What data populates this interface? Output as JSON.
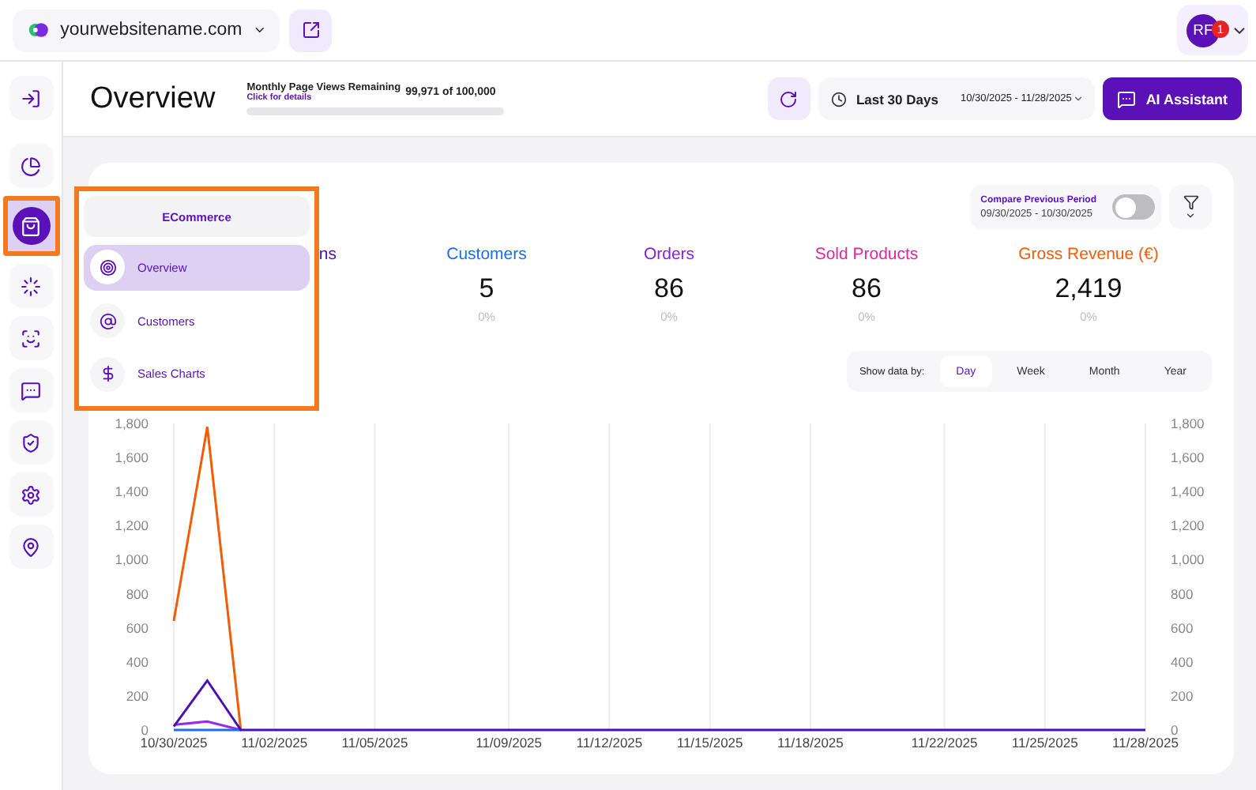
{
  "topbar": {
    "site": "yourwebsitename.com",
    "avatar": {
      "initials": "RF",
      "badge": "1"
    }
  },
  "sidebar": {
    "items": [
      {
        "selected": false,
        "highlighted": false
      },
      {
        "selected": false,
        "highlighted": false
      },
      {
        "selected": true,
        "highlighted": true
      },
      {
        "selected": false,
        "highlighted": false
      },
      {
        "selected": false,
        "highlighted": false
      },
      {
        "selected": false,
        "highlighted": false
      },
      {
        "selected": false,
        "highlighted": false
      },
      {
        "selected": false,
        "highlighted": false
      },
      {
        "selected": false,
        "highlighted": false
      }
    ]
  },
  "header": {
    "title": "Overview",
    "page_views": {
      "label": "Monthly Page Views Remaining",
      "link": "Click for details",
      "count": "99,971 of 100,000",
      "level": 0.0003
    },
    "date_range": {
      "preset": "Last 30 Days",
      "range": "10/30/2025 - 11/28/2025"
    },
    "assistant_button": "AI Assistant"
  },
  "popup_menu": {
    "highlighted": true,
    "title": "ECommerce",
    "items": [
      {
        "label": "Overview",
        "selected": true
      },
      {
        "label": "Customers",
        "selected": false
      },
      {
        "label": "Sales Charts",
        "selected": false
      }
    ]
  },
  "card": {
    "compare": {
      "label": "Compare Previous Period",
      "range": "09/30/2025 - 10/30/2025",
      "on": false
    },
    "metrics": [
      {
        "label": "ns",
        "color": "#4b0fb4"
      },
      {
        "label": "Customers",
        "value": "5",
        "change": "0%",
        "color": "#1a6ef0"
      },
      {
        "label": "Orders",
        "value": "86",
        "change": "0%",
        "color": "#8b1fe0"
      },
      {
        "label": "Sold Products",
        "value": "86",
        "change": "0%",
        "color": "#e0269a"
      },
      {
        "label": "Gross Revenue (€)",
        "value": "2,419",
        "change": "0%",
        "color": "#f25c05"
      }
    ],
    "show_by": {
      "label": "Show data by:",
      "options": [
        {
          "label": "Day",
          "selected": true
        },
        {
          "label": "Week",
          "selected": false
        },
        {
          "label": "Month",
          "selected": false
        },
        {
          "label": "Year",
          "selected": false
        }
      ]
    },
    "chart_data": {
      "type": "line",
      "grid": true,
      "categories": [
        "10/30/2025",
        null,
        null,
        "11/02/2025",
        null,
        null,
        "11/05/2025",
        null,
        null,
        null,
        "11/09/2025",
        null,
        null,
        "11/12/2025",
        null,
        null,
        "11/15/2025",
        null,
        null,
        "11/18/2025",
        null,
        null,
        null,
        "11/22/2025",
        null,
        null,
        "11/25/2025",
        null,
        null,
        "11/28/2025"
      ],
      "series": [
        {
          "color": "#f25c05",
          "values": [
            640,
            1780,
            0,
            null,
            null,
            null,
            null,
            null,
            null,
            null,
            null,
            null,
            null,
            null,
            null,
            null,
            null,
            null,
            null,
            null,
            null,
            null,
            null,
            null,
            null,
            null,
            null,
            null,
            null,
            null
          ]
        },
        {
          "color": "#9b27f0",
          "values": [
            30,
            50,
            0,
            null,
            null,
            null,
            null,
            null,
            null,
            null,
            null,
            null,
            null,
            null,
            null,
            null,
            null,
            null,
            null,
            null,
            null,
            null,
            null,
            null,
            null,
            null,
            null,
            null,
            null,
            null
          ]
        },
        {
          "color": "#1a6ef0",
          "values": [
            0,
            0,
            0,
            null,
            null,
            null,
            null,
            null,
            null,
            null,
            null,
            null,
            null,
            null,
            null,
            null,
            null,
            null,
            null,
            null,
            null,
            null,
            null,
            null,
            null,
            null,
            null,
            null,
            null,
            null
          ]
        },
        {
          "color": "#4b0fb4",
          "values": [
            20,
            290,
            0,
            0,
            0,
            0,
            0,
            0,
            0,
            0,
            0,
            0,
            0,
            0,
            0,
            0,
            0,
            0,
            0,
            0,
            0,
            0,
            0,
            0,
            0,
            0,
            0,
            0,
            0,
            0
          ]
        }
      ],
      "ylim": [
        0,
        1800
      ],
      "y2lim": [
        0,
        1800
      ],
      "yticks": [
        0,
        200,
        400,
        600,
        800,
        {
          "value": 1000,
          "label": "1,000"
        },
        {
          "value": 1200,
          "label": "1,200"
        },
        {
          "value": 1400,
          "label": "1,400"
        },
        {
          "value": 1600,
          "label": "1,600"
        },
        {
          "value": 1800,
          "label": "1,800"
        }
      ],
      "y2ticks": [
        0,
        200,
        400,
        600,
        800,
        {
          "value": 1000,
          "label": "1,000"
        },
        {
          "value": 1200,
          "label": "1,200"
        },
        {
          "value": 1400,
          "label": "1,400"
        },
        {
          "value": 1600,
          "label": "1,600"
        },
        {
          "value": 1800,
          "label": "1,800"
        }
      ]
    }
  }
}
